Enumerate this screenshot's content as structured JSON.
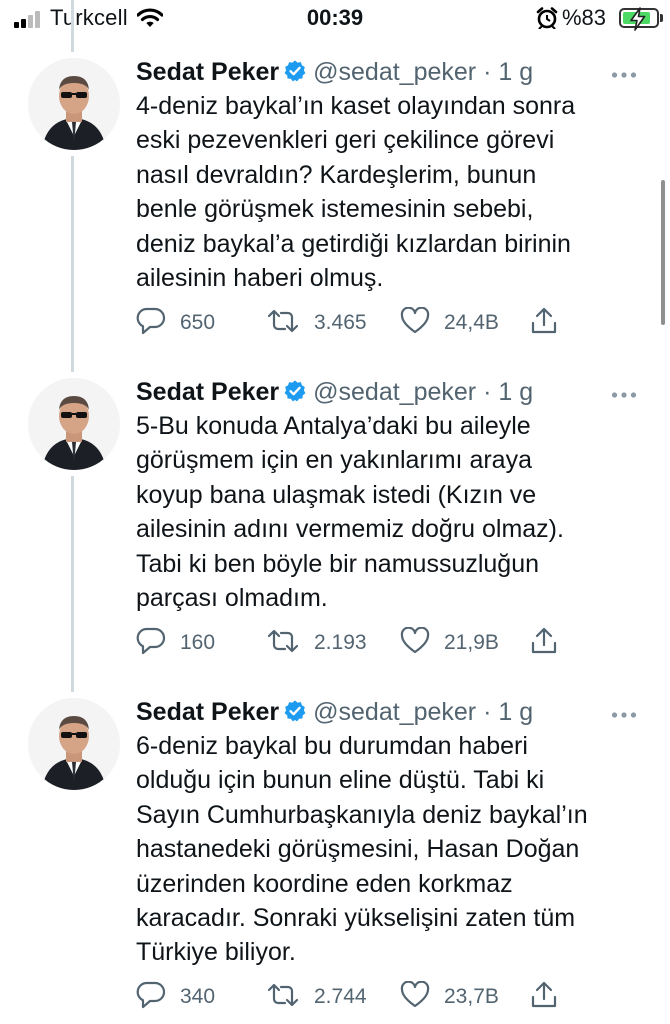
{
  "status_bar": {
    "carrier": "Turkcell",
    "time": "00:39",
    "battery_percent": "%83",
    "battery_level": 0.83,
    "icons": [
      "signal-icon",
      "wifi-icon",
      "alarm-icon",
      "battery-icon",
      "charging-bolt-icon"
    ]
  },
  "colors": {
    "verified": "#1d9bf0",
    "muted": "#536471",
    "thread_line": "#cfd9de",
    "battery_fill": "#4cd964"
  },
  "tweets": [
    {
      "name": "Sedat Peker",
      "handle": "@sedat_peker",
      "separator": "·",
      "time_ago": "1 g",
      "lines": [
        "4-deniz baykal’ın kaset olayından sonra",
        "eski pezevenkleri geri çekilince görevi",
        "nasıl devraldın? Kardeşlerim, bunun",
        "benle görüşmek istemesinin sebebi,",
        "deniz baykal’a getirdiği kızlardan birinin",
        "ailesinin haberi olmuş."
      ],
      "replies": "650",
      "retweets": "3.465",
      "likes": "24,4B"
    },
    {
      "name": "Sedat Peker",
      "handle": "@sedat_peker",
      "separator": "·",
      "time_ago": "1 g",
      "lines": [
        "5-Bu konuda Antalya’daki bu aileyle",
        "görüşmem için en yakınlarımı araya",
        "koyup bana ulaşmak istedi (Kızın ve",
        "ailesinin adını vermemiz doğru olmaz).",
        "Tabi ki ben böyle bir namussuzluğun",
        "parçası olmadım."
      ],
      "replies": "160",
      "retweets": "2.193",
      "likes": "21,9B"
    },
    {
      "name": "Sedat Peker",
      "handle": "@sedat_peker",
      "separator": "·",
      "time_ago": "1 g",
      "lines": [
        "6-deniz baykal bu durumdan haberi",
        "olduğu için bunun eline düştü. Tabi ki",
        "Sayın Cumhurbaşkanıyla deniz baykal’ın",
        "hastanedeki görüşmesini, Hasan Doğan",
        "üzerinden koordine eden korkmaz",
        "karacadır. Sonraki yükselişini zaten tüm",
        "Türkiye biliyor."
      ],
      "replies": "340",
      "retweets": "2.744",
      "likes": "23,7B"
    }
  ]
}
